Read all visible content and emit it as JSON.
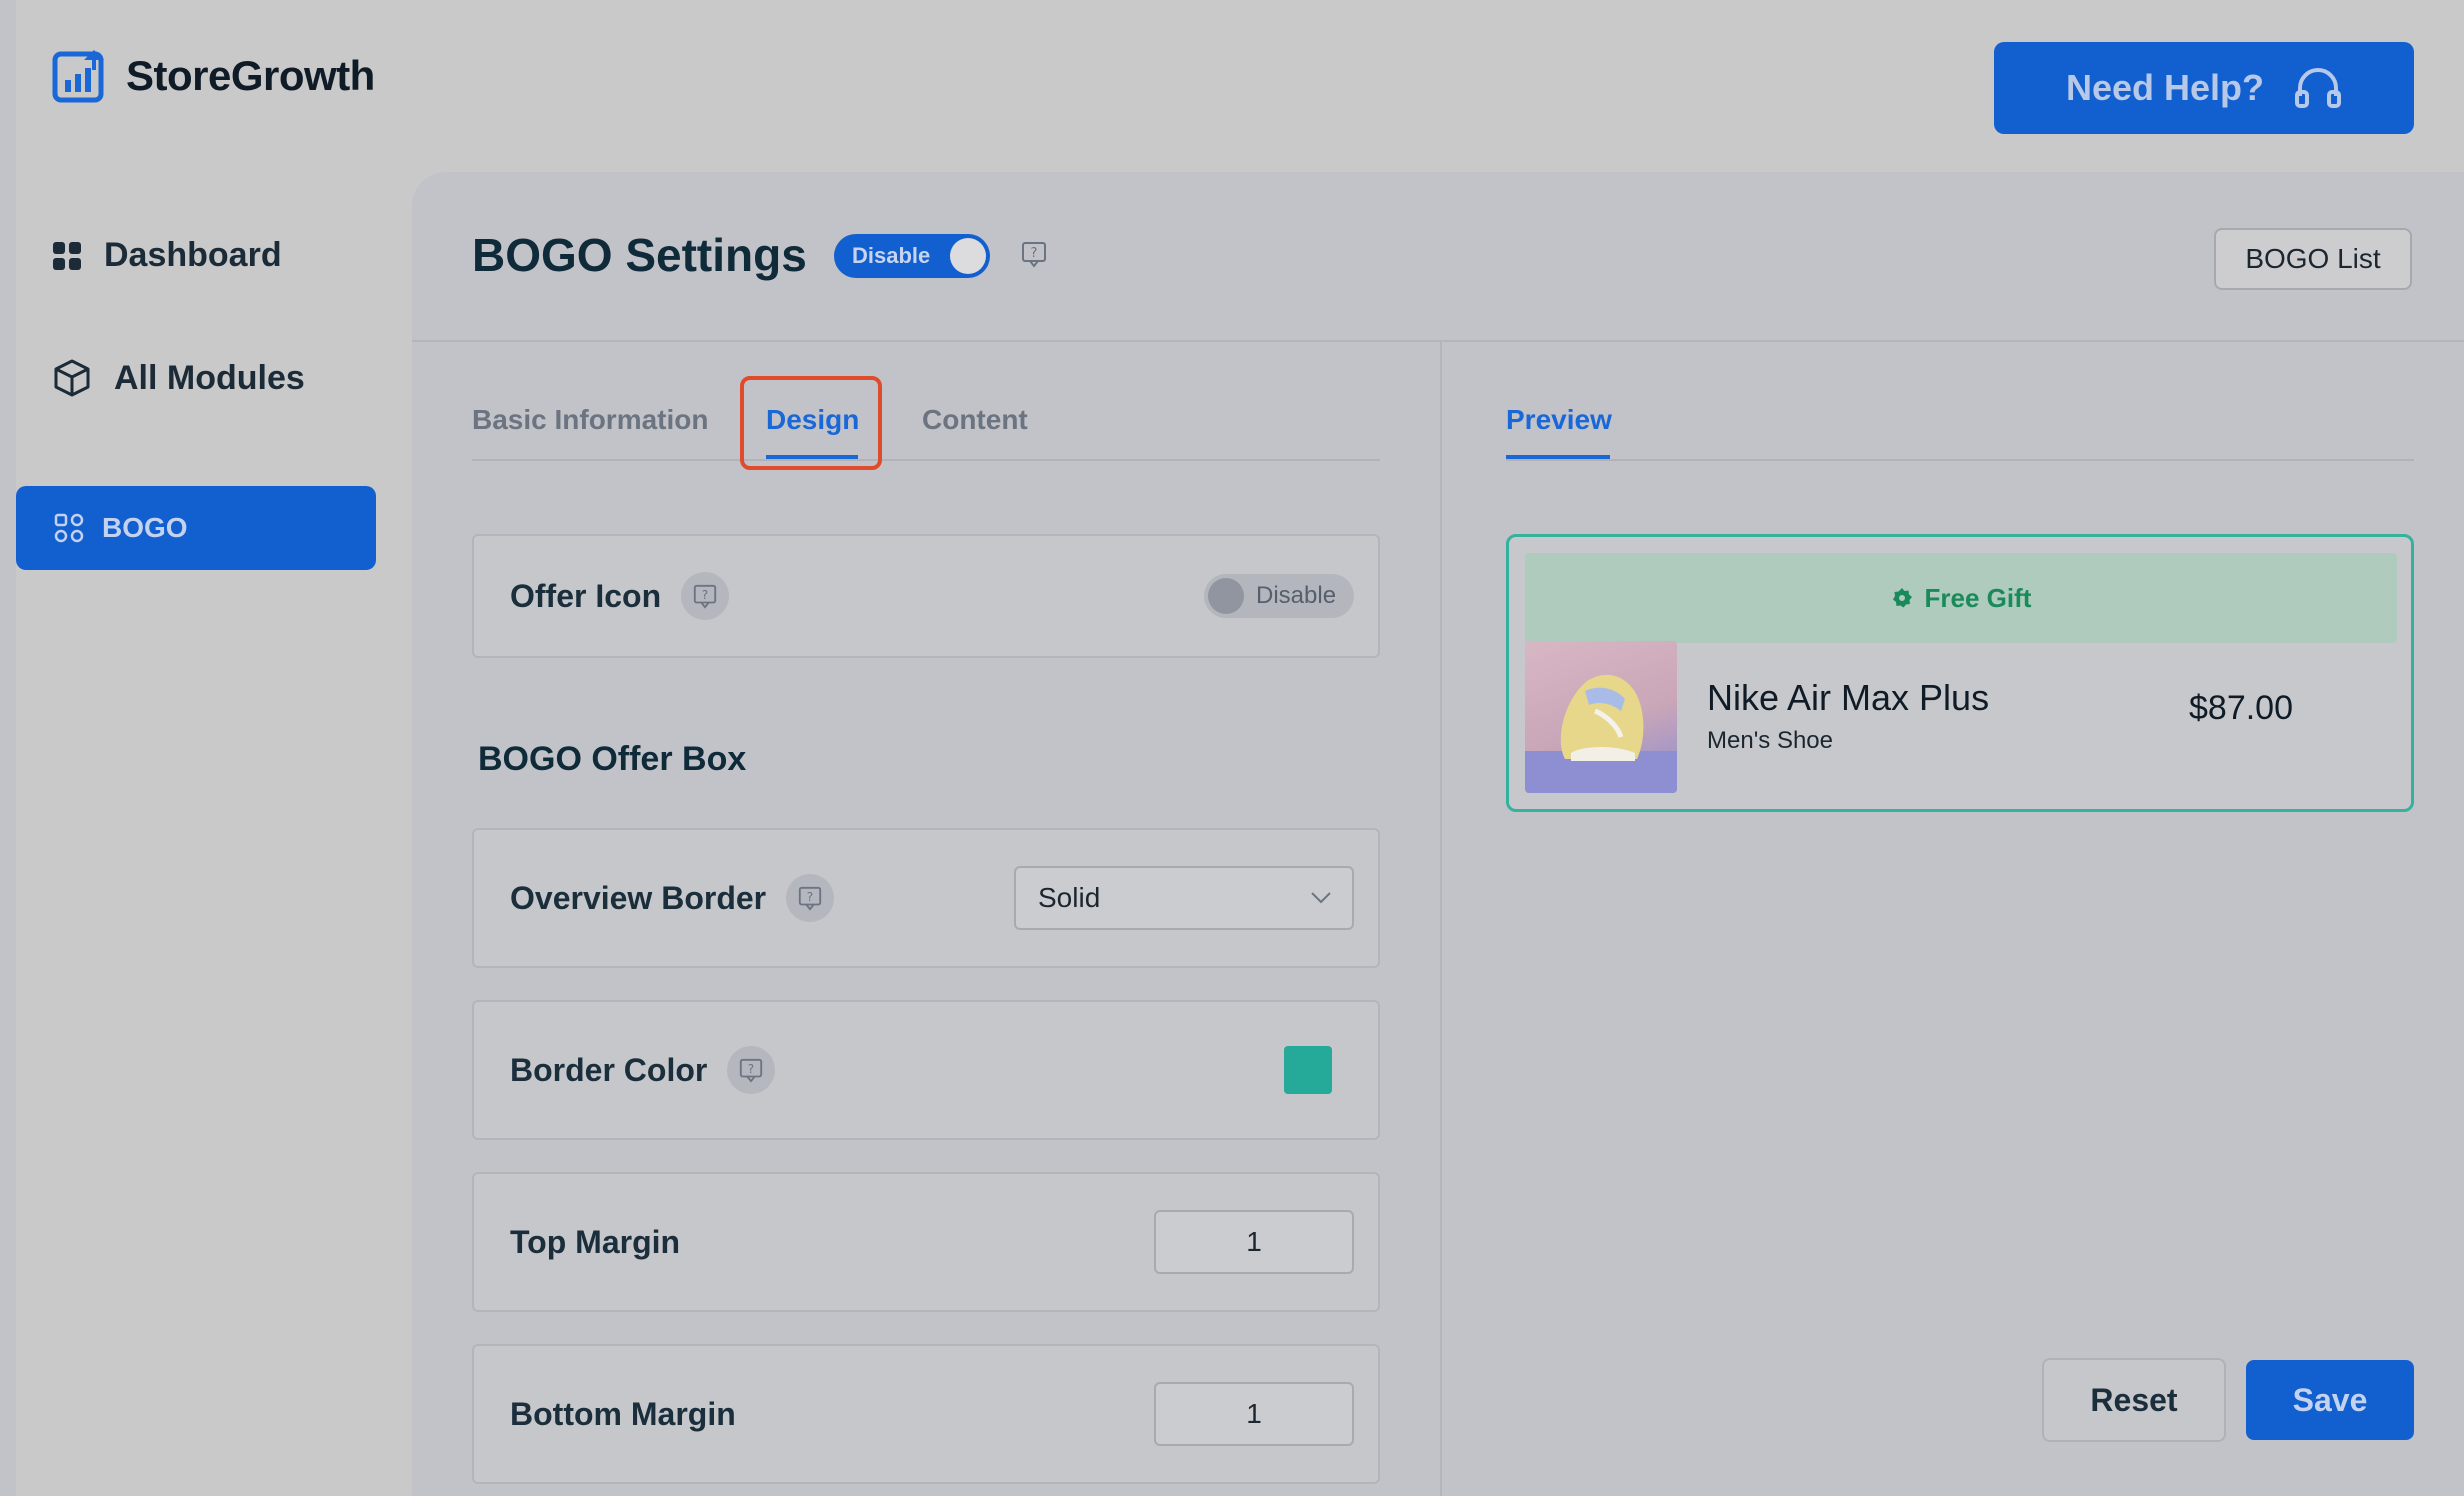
{
  "brand": {
    "name": "StoreGrowth",
    "icon": "bar-chart-logo-icon"
  },
  "header": {
    "help_label": "Need Help?",
    "help_icon": "headset-icon"
  },
  "sidebar": {
    "items": [
      {
        "label": "Dashboard",
        "icon": "dashboard-grid-icon"
      },
      {
        "label": "All Modules",
        "icon": "cube-icon"
      },
      {
        "label": "BOGO",
        "icon": "bogo-icon",
        "active": true
      }
    ]
  },
  "page": {
    "title": "BOGO Settings",
    "toggle_label": "Disable",
    "list_button": "BOGO List"
  },
  "tabs": [
    {
      "label": "Basic Information"
    },
    {
      "label": "Design",
      "active": true
    },
    {
      "label": "Content"
    }
  ],
  "settings": {
    "offer_icon": {
      "label": "Offer Icon",
      "toggle_label": "Disable"
    },
    "section_title": "BOGO Offer Box",
    "overview_border": {
      "label": "Overview Border",
      "value": "Solid"
    },
    "border_color": {
      "label": "Border Color",
      "value": "#25a998"
    },
    "top_margin": {
      "label": "Top Margin",
      "value": "1"
    },
    "bottom_margin": {
      "label": "Bottom Margin",
      "value": "1"
    }
  },
  "preview": {
    "tab_label": "Preview",
    "badge": "Free Gift",
    "product_name": "Nike Air Max Plus",
    "product_sub": "Men's Shoe",
    "price": "$87.00"
  },
  "actions": {
    "reset": "Reset",
    "save": "Save"
  },
  "colors": {
    "accent": "#125fd0",
    "border_green": "#34b29d",
    "highlight": "#e04b2b"
  }
}
